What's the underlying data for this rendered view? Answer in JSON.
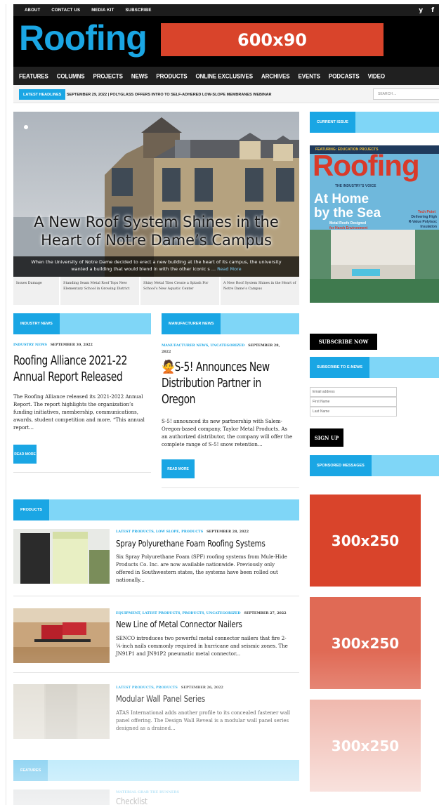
{
  "topbar": {
    "links": [
      "ABOUT",
      "CONTACT US",
      "MEDIA KIT",
      "SUBSCRIBE"
    ],
    "social": [
      "y",
      "f"
    ]
  },
  "header": {
    "logo": "Roofing",
    "ad_banner": "600x90"
  },
  "nav": {
    "items": [
      "FEATURES",
      "COLUMNS",
      "PROJECTS",
      "NEWS",
      "PRODUCTS",
      "ONLINE EXCLUSIVES",
      "ARCHIVES",
      "EVENTS",
      "PODCASTS",
      "VIDEO"
    ]
  },
  "ticker": {
    "tag": "LATEST HEADLINES",
    "text": "SEPTEMBER 29, 2022 | POLYGLASS OFFERS INTRO TO SELF-ADHERED LOW-SLOPE MEMBRANES WEBINAR",
    "search_placeholder": "SEARCH ..."
  },
  "hero": {
    "headline_line1": "A New Roof System Shines in the",
    "headline_line2": "Heart of Notre Dame’s Campus",
    "caption_line1": "When the University of Notre Dame decided to erect a new building at the heart of its campus, the university",
    "caption_line2": "wanted a building that would blend in with the other iconic s ...",
    "read_more": "Read More",
    "slides": [
      "Issues Damage",
      "Standing Seam Metal Roof Tops New Elementary School in Growing District",
      "Shiny Metal Tiles Create a Splash For School’s New Aquatic Center",
      "A New Roof System Shines in the Heart of Notre Dame’s Campus"
    ]
  },
  "industry_news": {
    "label": "INDUSTRY NEWS",
    "category": "INDUSTRY NEWS",
    "date": "SEPTEMBER 30, 2022",
    "title_line1": "Roofing Alliance 2021-22",
    "title_line2": "Annual Report Released",
    "excerpt": [
      "The Roofing Alliance released its 2021-2022 Annual",
      "Report. The report highlights the organization’s",
      "funding initiatives, membership, communications,",
      "awards, student competition and more. “This annual",
      "report..."
    ],
    "read_more": "READ MORE"
  },
  "manufacturer_news": {
    "label": "MANUFACTURER NEWS",
    "category": "MANUFACTURER NEWS, UNCATEGORIZED",
    "date": "SEPTEMBER 28,",
    "date2": "2022",
    "title_line1": "🙅S-5! Announces New",
    "title_line2": "Distribution Partner in",
    "title_line3": "Oregon",
    "excerpt": [
      "S-5! announced its new partnership with Salem-",
      "Oregon-based company, Taylor Metal Products. As",
      "an authorized distributor, the company will offer the",
      "complete range of S-5! snow retention..."
    ],
    "read_more": "READ MORE"
  },
  "sidebar": {
    "current_issue": "CURRENT ISSUE",
    "cover": {
      "kicker": "FEATURING: EDUCATION PROJECTS",
      "masthead": "Roofing",
      "tagline": "THE INDUSTRY’S VOICE",
      "headline1": "At Home",
      "headline2": "by the Sea",
      "sub1": "Metal Roofs Designed",
      "sub2": "for Harsh Environment",
      "side1": "Tech Point",
      "side2": "Delivering High",
      "side3": "R-Value Polyisoc",
      "side4": "Insulation"
    },
    "subscribe_now": "SUBSCRIBE NOW",
    "enews_label": "SUBSCRIBE TO E-NEWS",
    "fields": [
      "Email address",
      "First Name",
      "Last Name"
    ],
    "sign_up": "SIGN UP",
    "sponsored": "SPONSORED MESSAGES",
    "ads": [
      "300x250",
      "300x250",
      "300x250"
    ]
  },
  "products": {
    "label": "PRODUCTS",
    "items": [
      {
        "category": "LATEST PRODUCTS, LOW SLOPE, PRODUCTS",
        "date": "SEPTEMBER 28, 2022",
        "title": "Spray Polyurethane Foam Roofing Systems",
        "excerpt": [
          "Six Spray Polyurethane Foam (SPF) roofing systems from Mule-Hide",
          "Products Co. Inc. are now available nationwide. Previously only",
          "offered in Southwestern states, the systems have been rolled out",
          "nationally..."
        ]
      },
      {
        "category": "EQUIPMENT, LATEST PRODUCTS, PRODUCTS, UNCATEGORIZED",
        "date": "SEPTEMBER 27, 2022",
        "title": "New Line of Metal Connector Nailers",
        "excerpt": [
          "SENCO introduces two powerful metal connector nailers that fire 2-",
          "¼-inch nails commonly required in hurricane and seismic zones. The",
          "JN91P1 and JN91P2 pneumatic metal connector..."
        ]
      },
      {
        "category": "LATEST PRODUCTS, PRODUCTS",
        "date": "SEPTEMBER 26, 2022",
        "title": "Modular Wall Panel Series",
        "excerpt": [
          "ATAS International adds another profile to its concealed fastener wall",
          "panel offering. The Design Wall Reveal is a modular wall panel series",
          "designed as a drained..."
        ]
      }
    ]
  },
  "features": {
    "label": "FEATURES",
    "category": "MATERIAL GRAB THE RUNNERS",
    "title": "Checklist"
  }
}
